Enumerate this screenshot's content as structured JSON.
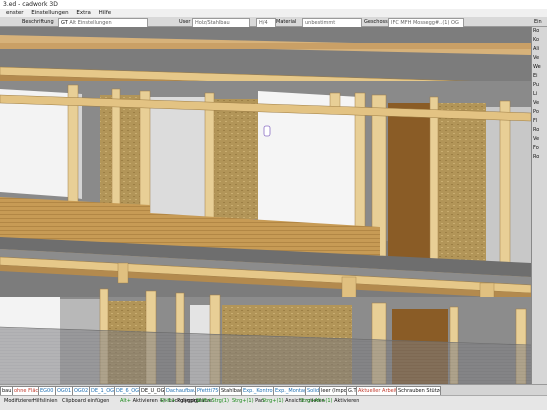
{
  "window": {
    "title": "3.ed - cadwork 3D"
  },
  "menu": [
    "enster",
    "Einstellungen",
    "Extra",
    "Hilfe"
  ],
  "toolbar": {
    "beschriftung_label": "Beschriftung",
    "beschriftung_value": "GT",
    "beschriftung_placeholder": "Alt Einstellungen",
    "user_label": "User",
    "user_value": "Holz/Stahlbau",
    "hoehe_label": "H/4",
    "material_label": "Material",
    "material_value": "unbestimmt",
    "geschoss_label": "Geschoss",
    "geschoss_value": "IFC MFH Mossegg#..(1) OG",
    "right_label": "Ein"
  },
  "right_panel": [
    "Ro",
    "Ko",
    "Ali",
    "Ve",
    "We",
    "Ei",
    "Pu",
    "Li",
    "Ve",
    "Po",
    "Fl",
    "Ro",
    "Ve",
    "Fo",
    "Ro"
  ],
  "tabs": [
    "bau",
    "ohne Flächen",
    "EG00",
    "OG01",
    "OG02",
    "DE_1_OG01",
    "DE_6_OG01",
    "DE_U_OG01",
    "Dachaufbauten",
    "Pfettti750",
    "Stahlbau",
    "Exp._Kontrollpl.",
    "Exp._Montagepl.",
    "Solid",
    "leer (Import)",
    "G.T",
    "Aktueller Arbeitsbereich",
    "Schrauben Stützenköpfe EG"
  ],
  "tab_colors": {
    "ohne Flächen": "#c0392b",
    "EG00": "#1f6fb2",
    "OG01": "#1f6fb2",
    "OG02": "#1f6fb2",
    "DE_1_OG01": "#1f6fb2",
    "DE_6_OG01": "#1f6fb2",
    "Dachaufbauten": "#1f6fb2",
    "Pfettti750": "#1f6fb2",
    "Exp._Kontrollpl.": "#1f6fb2",
    "Exp._Montagepl.": "#1f6fb2",
    "Solid": "#1f6fb2",
    "Aktueller Arbeitsbereich": "#c0392b"
  },
  "status": {
    "line1": [
      {
        "key": "",
        "text": "Modifizieren"
      },
      {
        "key": "",
        "text": "Hilfslinien"
      },
      {
        "key": "",
        "text": "Clipboard einfügen"
      },
      {
        "key": "Alt+",
        "text": "Aktivieren +/- Lückgängig"
      },
      {
        "key": "Shift+",
        "text": "Polygonplätze"
      },
      {
        "key": "Shift+Strg(1)",
        "text": ""
      },
      {
        "key": "Strg+(1)",
        "text": "Pan"
      },
      {
        "key": "Strg+(1)",
        "text": "Ansicht rotieren"
      },
      {
        "key": "Strg+Alt+(1)",
        "text": "Aktivieren"
      }
    ]
  }
}
